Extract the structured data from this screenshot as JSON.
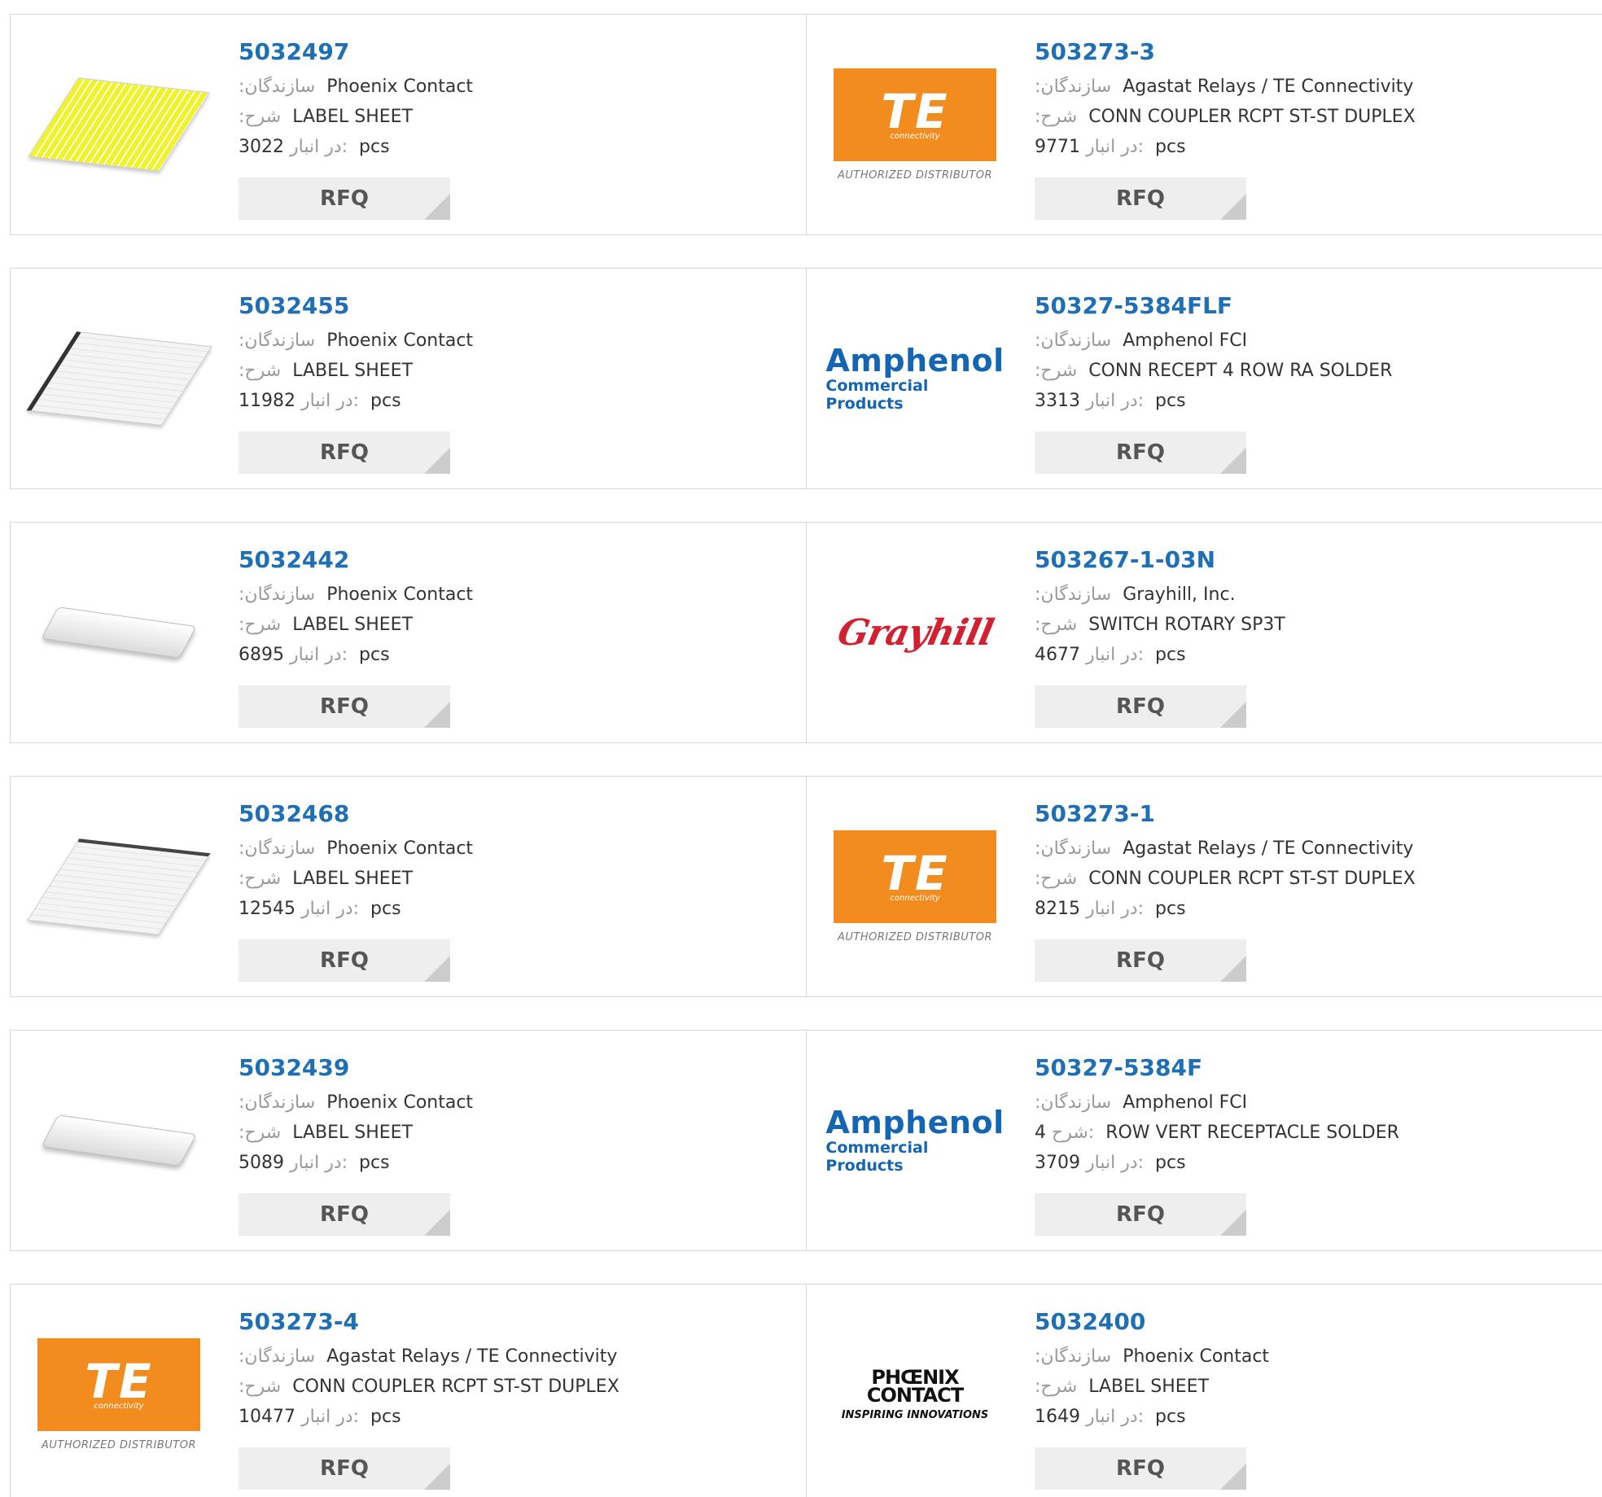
{
  "labels": {
    "manufacturer": ":سازندگان",
    "description": ":شرح",
    "stock": "در انبار:",
    "description_inline": "شرح:",
    "unit": "pcs",
    "rfq": "RFQ"
  },
  "logos": {
    "te_mark": "TE",
    "te_sub": "connectivity",
    "te_authorized": "AUTHORIZED DISTRIBUTOR",
    "amphenol_1": "Amphenol",
    "amphenol_2": "Commercial Products",
    "grayhill": "Grayhill",
    "phoenix_1": "PHŒNIX",
    "phoenix_2": "CONTACT",
    "phoenix_3": "INSPIRING INNOVATIONS"
  },
  "rows": [
    {
      "left": {
        "part": "5032497",
        "manufacturer": "Phoenix Contact",
        "description": "LABEL SHEET",
        "stock": "3022"
      },
      "right": {
        "part": "503273-3",
        "manufacturer": "Agastat Relays / TE Connectivity",
        "description": "CONN COUPLER RCPT ST-ST DUPLEX",
        "stock": "9771"
      }
    },
    {
      "left": {
        "part": "5032455",
        "manufacturer": "Phoenix Contact",
        "description": "LABEL SHEET",
        "stock": "11982"
      },
      "right": {
        "part": "50327-5384FLF",
        "manufacturer": "Amphenol FCI",
        "description": "CONN RECEPT 4 ROW RA SOLDER",
        "stock": "3313"
      }
    },
    {
      "left": {
        "part": "5032442",
        "manufacturer": "Phoenix Contact",
        "description": "LABEL SHEET",
        "stock": "6895"
      },
      "right": {
        "part": "503267-1-03N",
        "manufacturer": "Grayhill, Inc.",
        "description": "SWITCH ROTARY SP3T",
        "stock": "4677"
      }
    },
    {
      "left": {
        "part": "5032468",
        "manufacturer": "Phoenix Contact",
        "description": "LABEL SHEET",
        "stock": "12545"
      },
      "right": {
        "part": "503273-1",
        "manufacturer": "Agastat Relays / TE Connectivity",
        "description": "CONN COUPLER RCPT ST-ST DUPLEX",
        "stock": "8215"
      }
    },
    {
      "left": {
        "part": "5032439",
        "manufacturer": "Phoenix Contact",
        "description": "LABEL SHEET",
        "stock": "5089"
      },
      "right": {
        "part": "50327-5384F",
        "manufacturer": "Amphenol FCI",
        "description_prefix": "4",
        "description": "ROW VERT RECEPTACLE SOLDER",
        "stock": "3709"
      }
    },
    {
      "left": {
        "part": "503273-4",
        "manufacturer": "Agastat Relays / TE Connectivity",
        "description": "CONN COUPLER RCPT ST-ST DUPLEX",
        "stock": "10477"
      },
      "right": {
        "part": "5032400",
        "manufacturer": "Phoenix Contact",
        "description": "LABEL SHEET",
        "stock": "1649"
      }
    }
  ]
}
